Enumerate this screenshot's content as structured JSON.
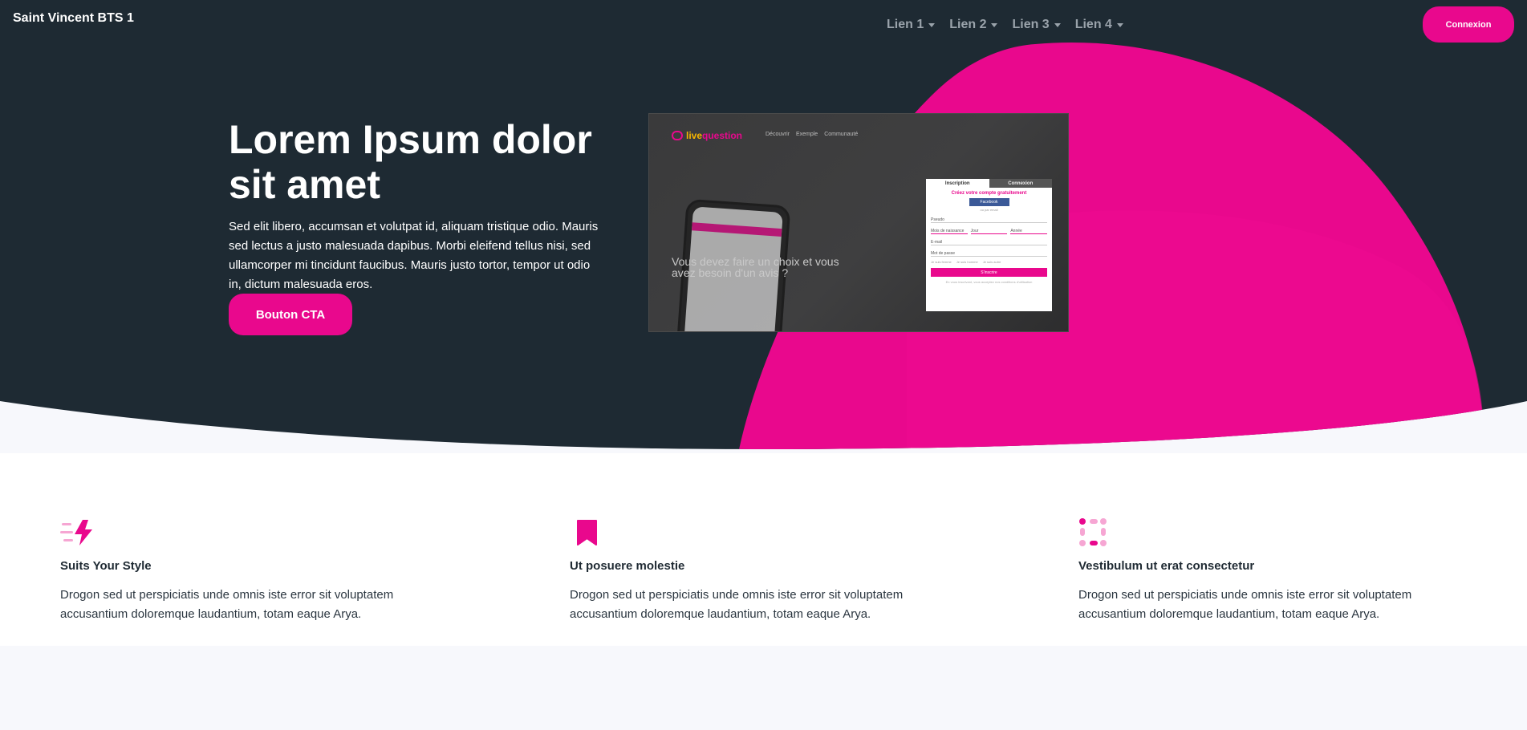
{
  "colors": {
    "accent": "#e9088d",
    "dark": "#1e2a33",
    "nav_link": "#9aa3ab"
  },
  "header": {
    "brand": "Saint Vincent BTS 1",
    "nav": [
      {
        "label": "Lien 1"
      },
      {
        "label": "Lien 2"
      },
      {
        "label": "Lien 3"
      },
      {
        "label": "Lien 4"
      }
    ],
    "login_label": "Connexion"
  },
  "hero": {
    "title": "Lorem Ipsum dolor sit amet",
    "text": "Sed elit libero, accumsan et volutpat id, aliquam tristique odio. Mauris sed lectus a justo malesuada dapibus. Morbi eleifend tellus nisi, sed ullamcorper mi tincidunt faucibus. Mauris justo tortor, tempor ut odio in, dictum malesuada eros.",
    "cta_label": "Bouton CTA"
  },
  "mockup": {
    "logo_part1": "live",
    "logo_part2": "question",
    "nav": [
      "Découvrir",
      "Exemple",
      "Communauté"
    ],
    "tagline": "Vous devez faire un choix et vous avez besoin d'un avis ?",
    "form": {
      "tab_signup": "Inscription",
      "tab_login": "Connexion",
      "title": "Créez votre compte gratuitement",
      "facebook": "Facebook",
      "or": "ou par email",
      "pseudo": "Pseudo",
      "birth_month": "Mois de naissance",
      "birth_day": "Jour",
      "birth_year": "Année",
      "email": "E-mail",
      "password": "Mot de passe",
      "radios": [
        "Je suis femme",
        "Je suis homme",
        "Je suis autre"
      ],
      "submit": "S'inscrire",
      "legal": "En vous inscrivant, vous acceptez nos conditions d'utilisation"
    }
  },
  "features": [
    {
      "icon": "lightning-icon",
      "title": "Suits Your Style",
      "text": "Drogon sed ut perspiciatis unde omnis iste error sit voluptatem accusantium doloremque laudantium, totam eaque Arya."
    },
    {
      "icon": "bookmark-icon",
      "title": "Ut posuere molestie",
      "text": "Drogon sed ut perspiciatis unde omnis iste error sit voluptatem accusantium doloremque laudantium, totam eaque Arya."
    },
    {
      "icon": "dots-circle-icon",
      "title": "Vestibulum ut erat consectetur",
      "text": "Drogon sed ut perspiciatis unde omnis iste error sit voluptatem accusantium doloremque laudantium, totam eaque Arya."
    }
  ]
}
